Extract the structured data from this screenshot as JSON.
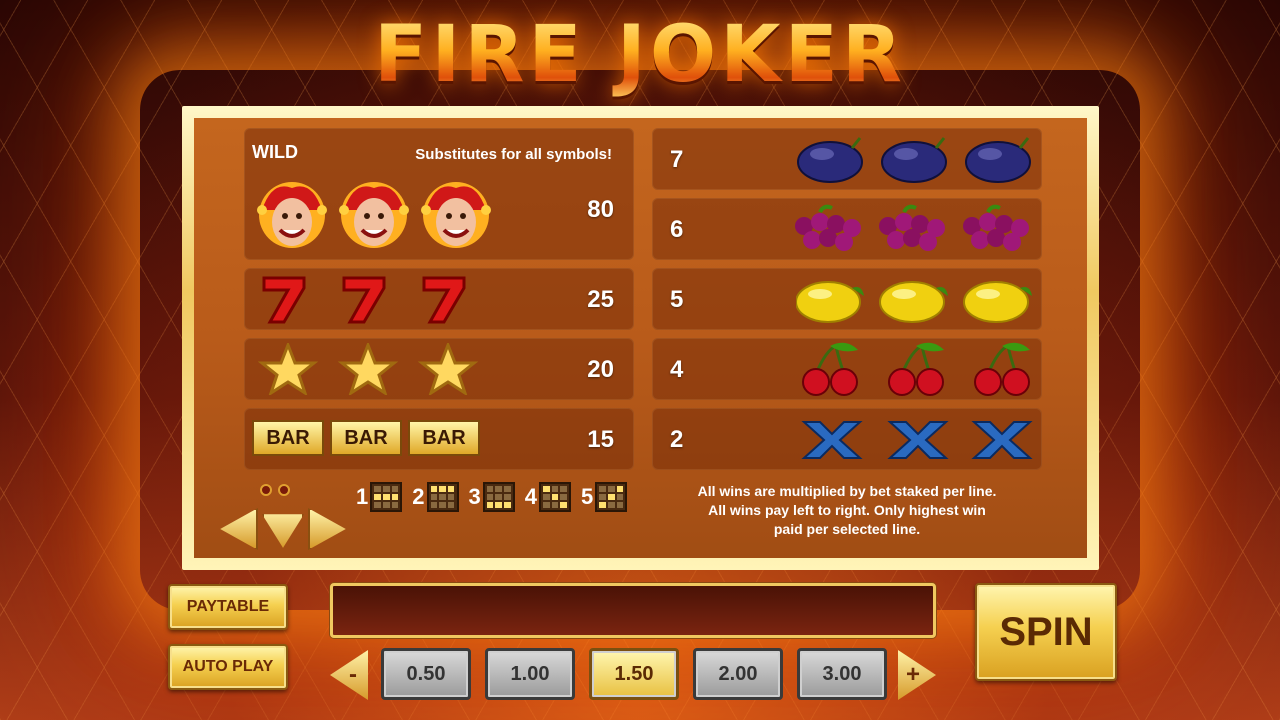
{
  "title": "FIRE JOKER",
  "wild": {
    "label": "WILD",
    "description": "Substitutes for all symbols!",
    "payout": "80"
  },
  "left_rows": [
    {
      "symbol": "seven-icon",
      "payout": "25"
    },
    {
      "symbol": "star-icon",
      "payout": "20"
    },
    {
      "symbol": "bar-icon",
      "payout": "15",
      "bar_text": "BAR"
    }
  ],
  "right_rows": [
    {
      "payout": "7",
      "symbol": "plum-icon"
    },
    {
      "payout": "6",
      "symbol": "grapes-icon"
    },
    {
      "payout": "5",
      "symbol": "lemon-icon"
    },
    {
      "payout": "4",
      "symbol": "cherry-icon"
    },
    {
      "payout": "2",
      "symbol": "x-icon"
    }
  ],
  "paylines": [
    "1",
    "2",
    "3",
    "4",
    "5"
  ],
  "info_text": "All wins are multiplied by bet staked per line. All wins pay left to right. Only highest win paid per selected line.",
  "info_lines": [
    "All wins are multiplied by bet staked per line.",
    "All wins pay left to right. Only highest win",
    "paid per selected line."
  ],
  "controls": {
    "paytable_label": "PAYTABLE",
    "autoplay_label": "AUTO PLAY",
    "spin_label": "SPIN",
    "minus_label": "-",
    "plus_label": "+",
    "bets": [
      "0.50",
      "1.00",
      "1.50",
      "2.00",
      "3.00"
    ],
    "selected_bet": "1.50"
  },
  "colors": {
    "panel": "#b95b1a",
    "gold": "#f5d050",
    "accent": "#e0500a"
  }
}
